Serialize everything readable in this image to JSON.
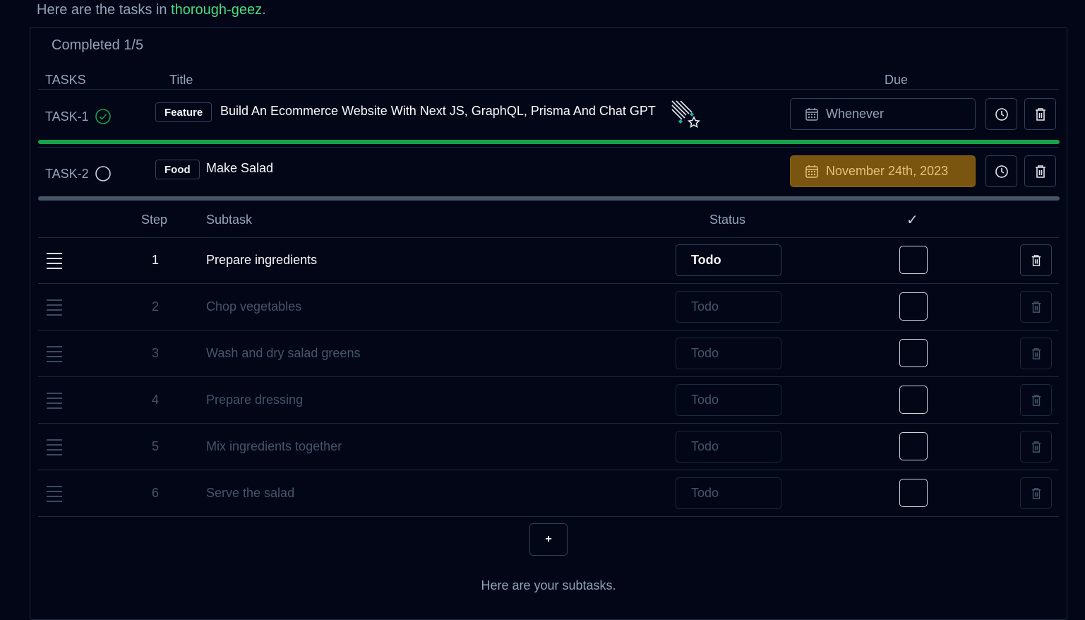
{
  "intro": {
    "prefix": "Here are the tasks in ",
    "project": "thorough-geez",
    "suffix": "."
  },
  "summary": {
    "completed": "Completed 1/5"
  },
  "columns": {
    "tasks": "TASKS",
    "title": "Title",
    "due": "Due"
  },
  "tasks": [
    {
      "id": "TASK-1",
      "done": true,
      "tag": "Feature",
      "title": "Build An Ecommerce Website With Next JS, GraphQL, Prisma And Chat GPT",
      "due": "Whenever",
      "progress_color": "#16a34a",
      "progress": 1.0
    },
    {
      "id": "TASK-2",
      "done": false,
      "tag": "Food",
      "title": "Make Salad",
      "due": "November 24th, 2023",
      "due_color": "#7a5510",
      "progress_color": "#475569",
      "progress": 0
    }
  ],
  "subtask_columns": {
    "step": "Step",
    "subtask": "Subtask",
    "status": "Status",
    "check": "✓"
  },
  "subtasks": [
    {
      "step": "1",
      "text": "Prepare ingredients",
      "status": "Todo",
      "checked": false
    },
    {
      "step": "2",
      "text": "Chop vegetables",
      "status": "Todo",
      "checked": false
    },
    {
      "step": "3",
      "text": "Wash and dry salad greens",
      "status": "Todo",
      "checked": false
    },
    {
      "step": "4",
      "text": "Prepare dressing",
      "status": "Todo",
      "checked": false
    },
    {
      "step": "5",
      "text": "Mix ingredients together",
      "status": "Todo",
      "checked": false
    },
    {
      "step": "6",
      "text": "Serve the salad",
      "status": "Todo",
      "checked": false
    }
  ],
  "add_button": "+",
  "footer": "Here are your subtasks."
}
